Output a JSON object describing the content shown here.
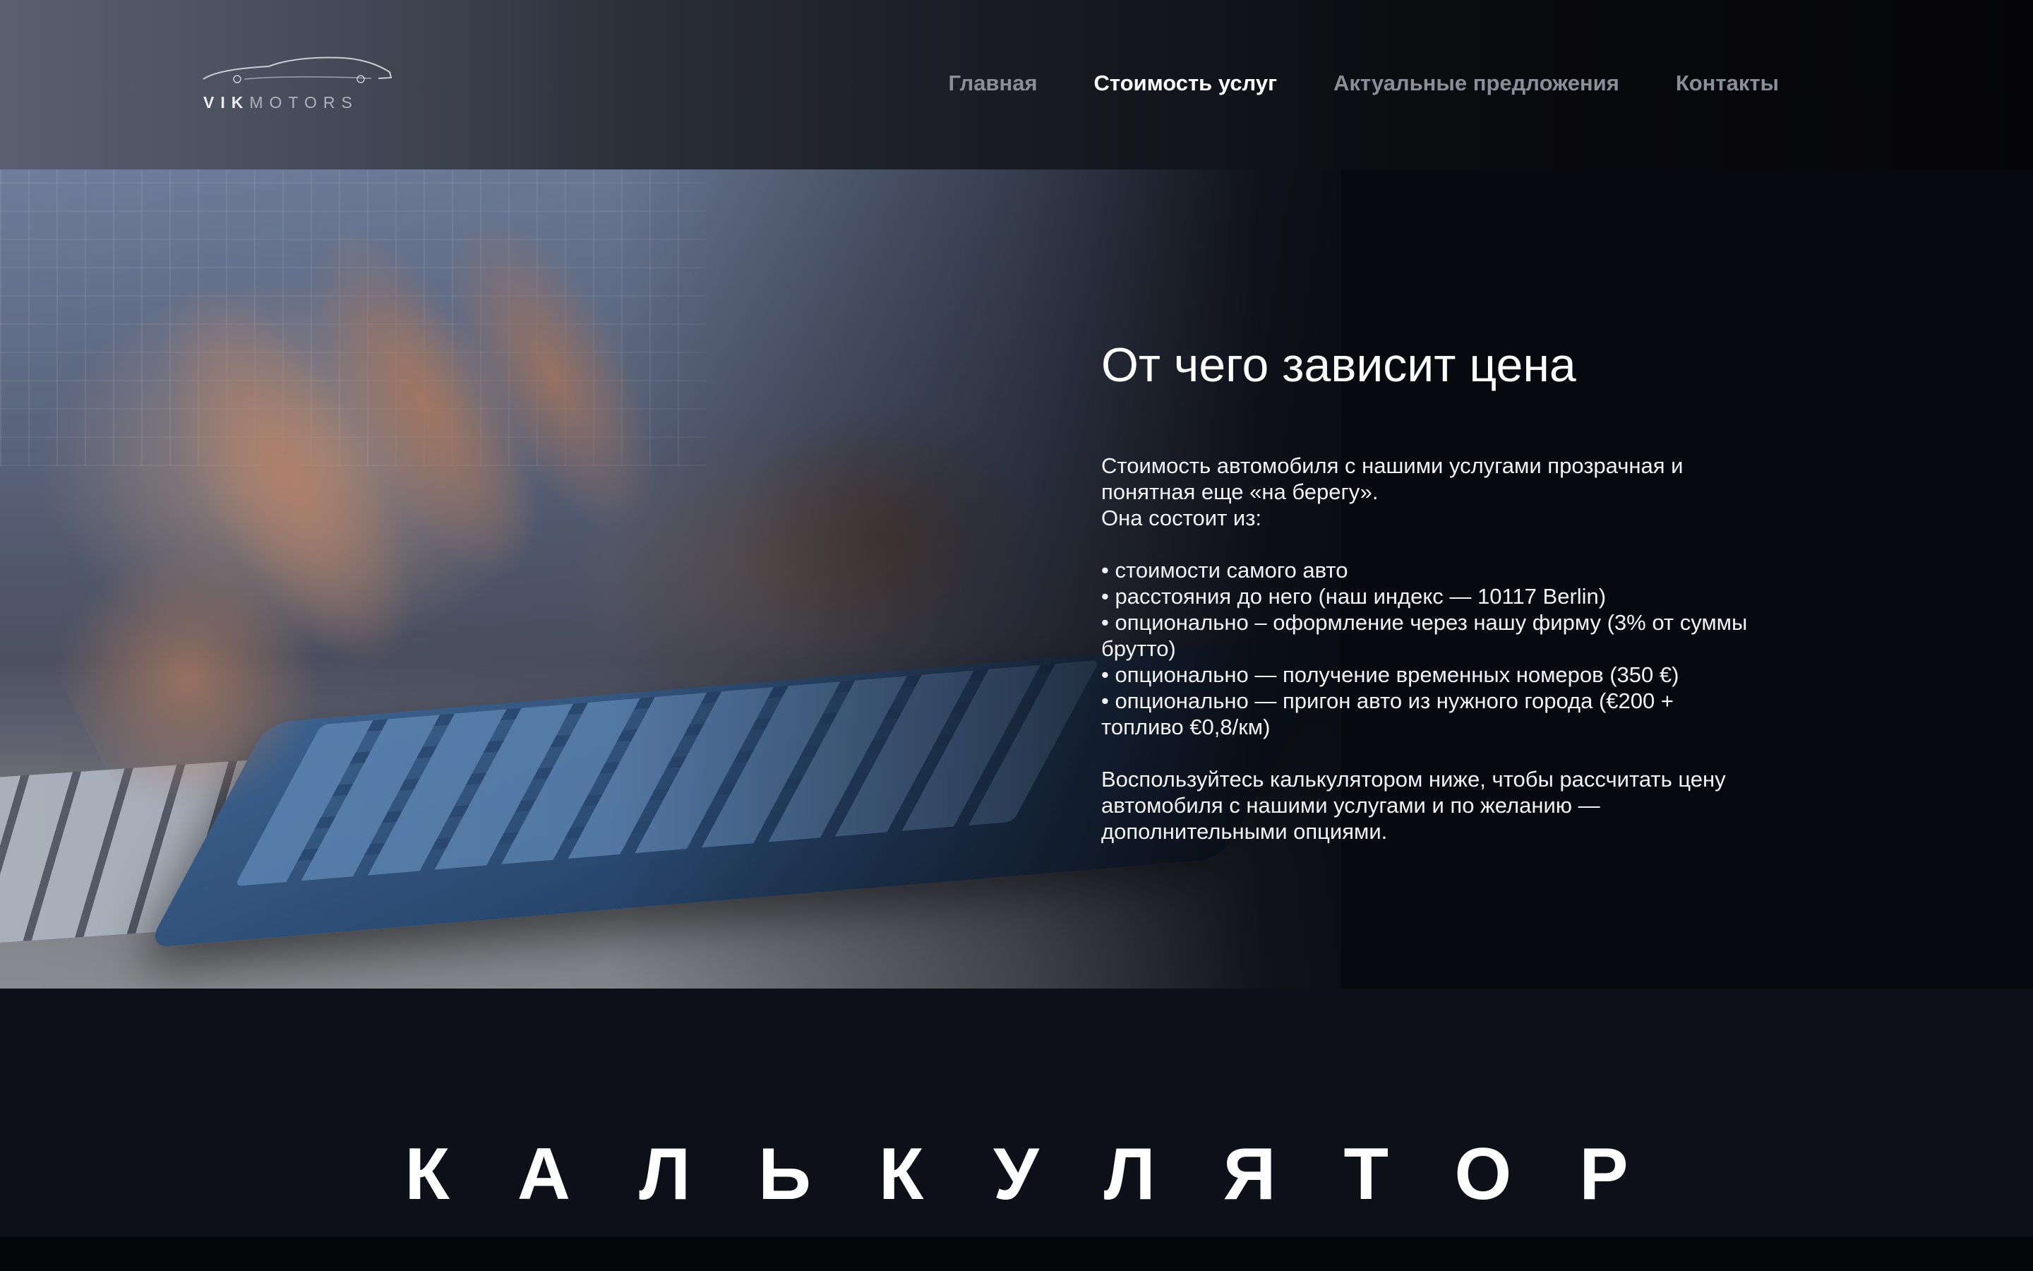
{
  "header": {
    "logo": {
      "bold": "VIK",
      "light": "MOTORS"
    },
    "nav": [
      {
        "label": "Главная",
        "active": false
      },
      {
        "label": "Стоимость услуг",
        "active": true
      },
      {
        "label": "Актуальные предложения",
        "active": false
      },
      {
        "label": "Контакты",
        "active": false
      }
    ]
  },
  "hero": {
    "title": "От чего зависит цена",
    "paragraphs": [
      [
        "Стоимость автомобиля с нашими услугами прозрачная и",
        "понятная еще «на берегу».",
        "Она состоит из:"
      ],
      [
        "• стоимости самого авто",
        "• расстояния до него (наш индекс — 10117 Berlin)",
        "• опционально – оформление через нашу фирму (3% от суммы",
        "брутто)",
        "• опционально — получение временных номеров (350 €)",
        "• опционально — пригон авто из нужного города (€200 +",
        "топливо €0,8/км)"
      ],
      [
        "Воспользуйтесь калькулятором ниже, чтобы рассчитать цену",
        "автомобиля с нашими услугами и по желанию —",
        "дополнительными опциями."
      ]
    ]
  },
  "calculator": {
    "title": "КАЛЬКУЛЯТОР"
  },
  "colors": {
    "background": "#0d1019",
    "nav_inactive": "#8a8e98",
    "nav_active": "#ffffff",
    "text": "#ffffff"
  }
}
